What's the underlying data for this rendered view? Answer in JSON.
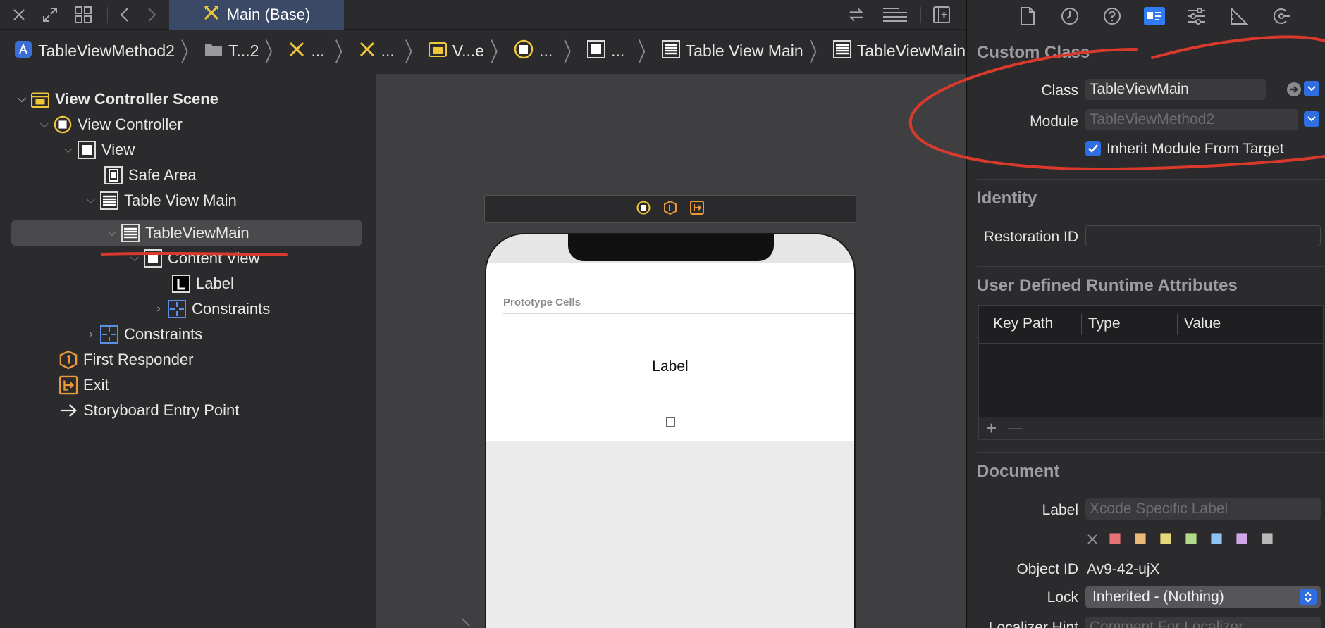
{
  "toolbar": {
    "tab_title": "Main (Base)",
    "icons": [
      "close-icon",
      "expand-icon",
      "grid-icon",
      "back-icon",
      "forward-icon",
      "swap-icon",
      "lines-icon",
      "add-editor-icon"
    ]
  },
  "breadcrumb": {
    "items": [
      {
        "label": "TableViewMethod2",
        "icon": "project-icon"
      },
      {
        "label": "T...2",
        "icon": "folder-icon"
      },
      {
        "label": "...",
        "icon": "storyboard-icon"
      },
      {
        "label": "...",
        "icon": "storyboard-icon"
      },
      {
        "label": "V...e",
        "icon": "scene-icon"
      },
      {
        "label": "...",
        "icon": "view-controller-icon"
      },
      {
        "label": "...",
        "icon": "view-icon"
      },
      {
        "label": "Table View Main",
        "icon": "table-view-icon"
      },
      {
        "label": "TableViewMain",
        "icon": "table-cell-icon"
      }
    ]
  },
  "outline": {
    "rows": [
      {
        "label": "View Controller Scene",
        "icon": "scene-icon",
        "disclosure": "open"
      },
      {
        "label": "View Controller",
        "icon": "view-controller-icon",
        "disclosure": "open"
      },
      {
        "label": "View",
        "icon": "view-icon",
        "disclosure": "open"
      },
      {
        "label": "Safe Area",
        "icon": "safe-area-icon",
        "disclosure": "none"
      },
      {
        "label": "Table View Main",
        "icon": "table-view-icon",
        "disclosure": "open"
      },
      {
        "label": "TableViewMain",
        "icon": "table-cell-icon",
        "disclosure": "open",
        "selected": true
      },
      {
        "label": "Content View",
        "icon": "view-icon",
        "disclosure": "open"
      },
      {
        "label": "Label",
        "icon": "label-icon",
        "disclosure": "none"
      },
      {
        "label": "Constraints",
        "icon": "constraints-icon",
        "disclosure": "closed"
      },
      {
        "label": "Constraints",
        "icon": "constraints-icon",
        "disclosure": "closed"
      },
      {
        "label": "First Responder",
        "icon": "first-responder-icon",
        "disclosure": "none"
      },
      {
        "label": "Exit",
        "icon": "exit-icon",
        "disclosure": "none"
      },
      {
        "label": "Storyboard Entry Point",
        "icon": "entry-arrow-icon",
        "disclosure": "none"
      }
    ]
  },
  "canvas": {
    "prototype_cells_label": "Prototype Cells",
    "cell_label": "Label"
  },
  "inspector": {
    "tabs": [
      "file-icon",
      "history-icon",
      "help-icon",
      "identity-icon",
      "attributes-icon",
      "size-icon",
      "connections-icon"
    ],
    "active_tab": "identity-icon",
    "custom_class": {
      "title": "Custom Class",
      "class_label": "Class",
      "class_value": "TableViewMain",
      "module_label": "Module",
      "module_placeholder": "TableViewMethod2",
      "inherit_label": "Inherit Module From Target",
      "inherit_checked": true
    },
    "identity": {
      "title": "Identity",
      "restoration_label": "Restoration ID",
      "restoration_value": ""
    },
    "runtime_attrs": {
      "title": "User Defined Runtime Attributes",
      "columns": [
        "Key Path",
        "Type",
        "Value"
      ],
      "add": "+",
      "remove": "—"
    },
    "document": {
      "title": "Document",
      "label_label": "Label",
      "label_placeholder": "Xcode Specific Label",
      "object_id_label": "Object ID",
      "object_id_value": "Av9-42-ujX",
      "lock_label": "Lock",
      "lock_value": "Inherited - (Nothing)",
      "localizer_label": "Localizer Hint",
      "localizer_placeholder": "Comment For Localizer",
      "swatch_colors": [
        "#e57373",
        "#e8b978",
        "#e6d77a",
        "#b5d98c",
        "#8ec3f0",
        "#cfa6e8",
        "#b8b8b8"
      ]
    }
  },
  "accent": "#2f7cf6",
  "annotation_color": "#d93a2b"
}
